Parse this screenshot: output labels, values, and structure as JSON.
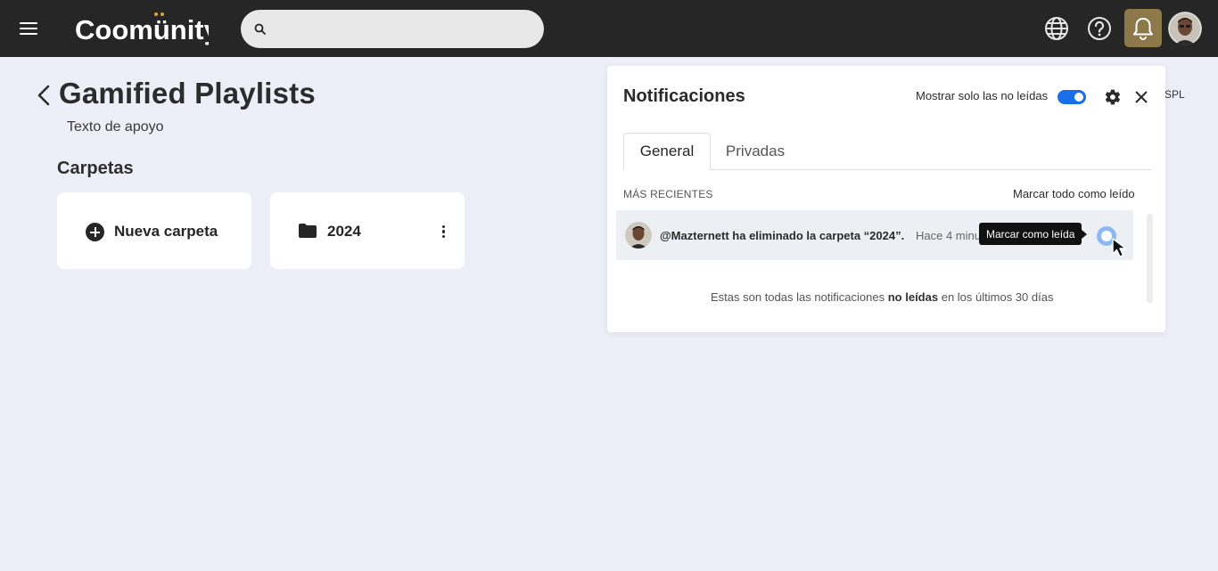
{
  "topbar": {
    "logo_text": "Coomünity",
    "search": {
      "placeholder": "",
      "value": ""
    },
    "icons": [
      "menu-icon",
      "search-icon",
      "globe-icon",
      "help-icon",
      "bell-icon",
      "user-avatar"
    ],
    "bell_bg": "#8d7849"
  },
  "page": {
    "title": "Gamified Playlists",
    "subtitle": "Texto de apoyo",
    "section_title": "Carpetas",
    "new_folder_label": "Nueva carpeta",
    "folder_name": "2024",
    "lang_peek": "SPL"
  },
  "notifications": {
    "title": "Notificaciones",
    "unread_only_label": "Mostrar solo las no leídas",
    "unread_only_on": true,
    "tabs": [
      {
        "label": "General",
        "active": true
      },
      {
        "label": "Privadas",
        "active": false
      }
    ],
    "recent_label": "MÁS RECIENTES",
    "mark_all_label": "Marcar todo como leído",
    "items": [
      {
        "text": "@Mazternett ha eliminado la carpeta “2024”.",
        "time": "Hace 4 minutos",
        "tooltip": "Marcar como leída"
      }
    ],
    "footer_pre": "Estas son todas las notificaciones",
    "footer_bold": "no leídas",
    "footer_post": "en los últimos 30 días",
    "accent": "#1a6fe8"
  }
}
